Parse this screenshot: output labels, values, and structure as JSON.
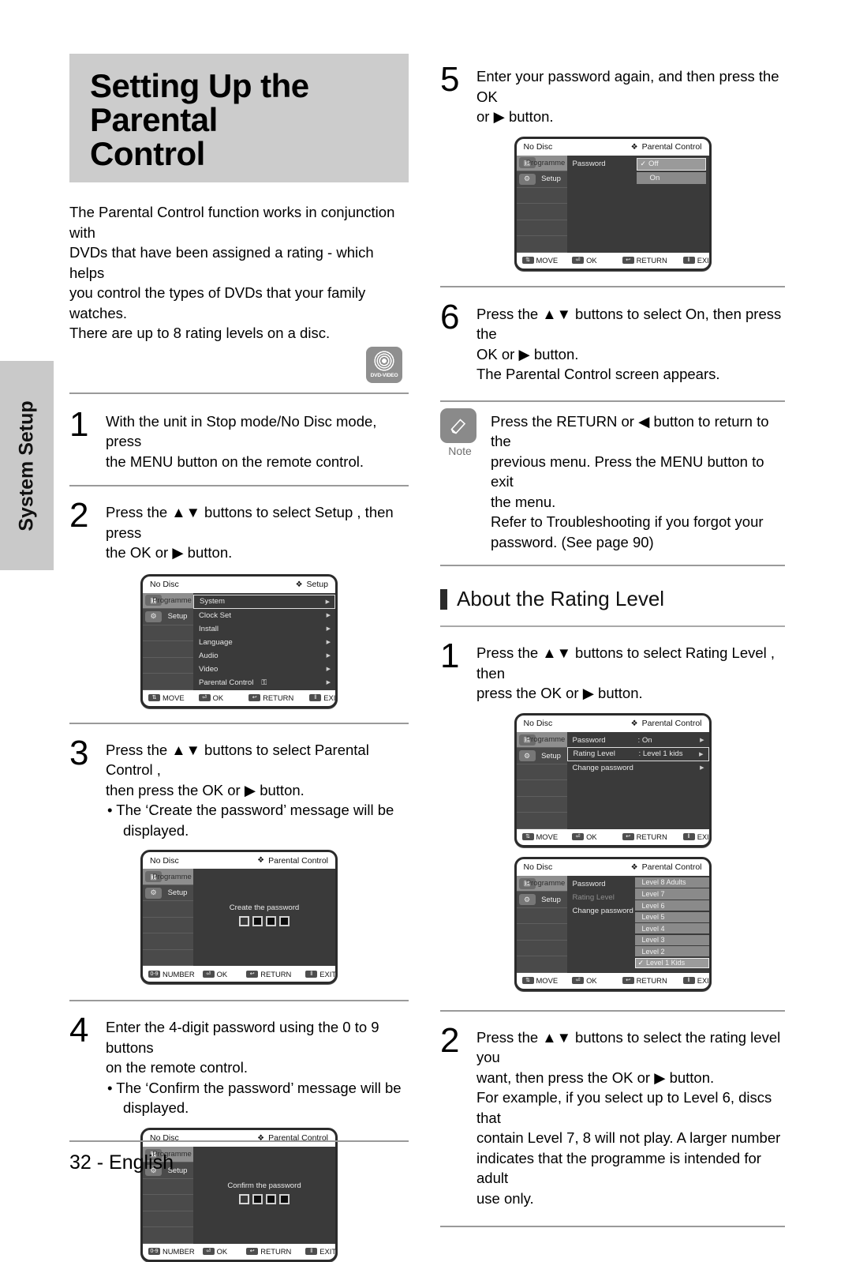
{
  "side_tab": {
    "label": "System Setup"
  },
  "header": {
    "title_line1": "Setting Up the Parental",
    "title_line2": "Control"
  },
  "intro": {
    "line1": "The Parental Control function works in conjunction with",
    "line2": "DVDs that have been assigned a rating - which helps",
    "line3": "you control the types of DVDs that your family watches.",
    "line4": "There are up to 8 rating levels on a disc."
  },
  "badge": {
    "label": "DVD-VIDEO",
    "icon": "dvd-video-disc-icon"
  },
  "steps_left": [
    {
      "num": "1",
      "lines": [
        "With the unit in Stop mode/No Disc mode, press",
        "the MENU button on the remote control."
      ]
    },
    {
      "num": "2",
      "lines": [
        "Press the ▲▼ buttons to select Setup , then press",
        "the OK or ▶ button."
      ]
    },
    {
      "num": "3",
      "lines": [
        "Press the ▲▼ buttons to select Parental Control ,",
        "then press the OK or ▶ button."
      ],
      "bullets": [
        "• The ‘Create the password’ message will be",
        "  displayed."
      ]
    },
    {
      "num": "4",
      "lines": [
        "Enter the 4-digit password using the 0 to 9 buttons",
        "on the remote control."
      ],
      "bullets": [
        "• The ‘Confirm the password’ message will be",
        "  displayed."
      ]
    }
  ],
  "steps_right": [
    {
      "num": "5",
      "lines": [
        "Enter your password again, and then press the OK",
        "or ▶ button."
      ]
    },
    {
      "num": "6",
      "lines": [
        "Press the ▲▼ buttons to select On, then press the",
        "OK or ▶ button.",
        "The Parental Control screen appears."
      ]
    }
  ],
  "note": {
    "icon": "pencil-icon",
    "label": "Note",
    "lines": [
      "Press the RETURN or ◀ button to return to the",
      "previous menu. Press the MENU button to exit",
      "the menu.",
      "Refer to Troubleshooting if you forgot your",
      "password. (See page 90)"
    ]
  },
  "section": {
    "title": "About the Rating Level"
  },
  "rating_steps": [
    {
      "num": "1",
      "lines": [
        "Press the ▲▼ buttons to select Rating Level , then",
        "press the OK or ▶ button."
      ]
    },
    {
      "num": "2",
      "lines": [
        "Press the ▲▼ buttons to select the rating level you",
        "want, then press the OK or ▶ button.",
        "For example, if you select up to Level 6, discs that",
        "contain Level 7, 8 will not play. A larger number",
        "indicates that the programme is intended for adult",
        "use only."
      ]
    }
  ],
  "osd_common": {
    "disc_state": "No Disc",
    "diamond": "❖",
    "sidebar": {
      "programme": "Programme",
      "setup": "Setup"
    },
    "keys": {
      "move": "MOVE",
      "ok": "OK",
      "return": "RETURN",
      "exit": "EXIT",
      "number": "NUMBER",
      "number_key": "0-9",
      "move_key": "⇅",
      "ok_key": "⏎",
      "return_key": "↩",
      "exit_key": "‖"
    }
  },
  "osd_setup": {
    "context": "Setup",
    "items": [
      {
        "label": "System",
        "selected": true
      },
      {
        "label": "Clock Set",
        "selected": false
      },
      {
        "label": "Install",
        "selected": false
      },
      {
        "label": "Language",
        "selected": false
      },
      {
        "label": "Audio",
        "selected": false
      },
      {
        "label": "Video",
        "selected": false
      },
      {
        "label": "Parental Control",
        "selected": false,
        "lock": "⚿"
      }
    ]
  },
  "osd_create_password": {
    "context": "Parental Control",
    "message": "Create the password",
    "boxes": [
      false,
      true,
      true,
      true
    ]
  },
  "osd_confirm_password": {
    "context": "Parental Control",
    "message": "Confirm the password",
    "boxes": [
      false,
      true,
      true,
      true
    ]
  },
  "osd_password_toggle": {
    "context": "Parental Control",
    "row_label": "Password",
    "options": [
      {
        "label": "Off",
        "checked": true,
        "selected": true
      },
      {
        "label": "On",
        "checked": false,
        "selected": false
      }
    ]
  },
  "osd_parental_menu": {
    "context": "Parental Control",
    "rows": [
      {
        "label": "Password",
        "value": ": On",
        "selected": false
      },
      {
        "label": "Rating Level",
        "value": ":  Level 1 kids",
        "selected": true
      },
      {
        "label": "Change password",
        "value": "",
        "selected": false
      }
    ]
  },
  "osd_rating_list": {
    "context": "Parental Control",
    "rows": [
      {
        "label": "Password",
        "dim": false
      },
      {
        "label": "Rating Level",
        "dim": true
      },
      {
        "label": "Change password",
        "dim": false
      }
    ],
    "levels": [
      {
        "label": "Level 8 Adults",
        "selected": false
      },
      {
        "label": "Level 7",
        "selected": false
      },
      {
        "label": "Level 6",
        "selected": false
      },
      {
        "label": "Level 5",
        "selected": false
      },
      {
        "label": "Level 4",
        "selected": false
      },
      {
        "label": "Level 3",
        "selected": false
      },
      {
        "label": "Level 2",
        "selected": false
      },
      {
        "label": "Level 1 Kids",
        "selected": true,
        "check": "✓"
      }
    ]
  },
  "footer": {
    "page": "32 - English"
  },
  "colors": {
    "banner_bg": "#cccccc",
    "side_tab_bg": "#c9c9c9",
    "osd_bg": "#3a3a3a",
    "osd_sidebar": "#4a4a4a",
    "highlight": "#8e8e8e"
  }
}
